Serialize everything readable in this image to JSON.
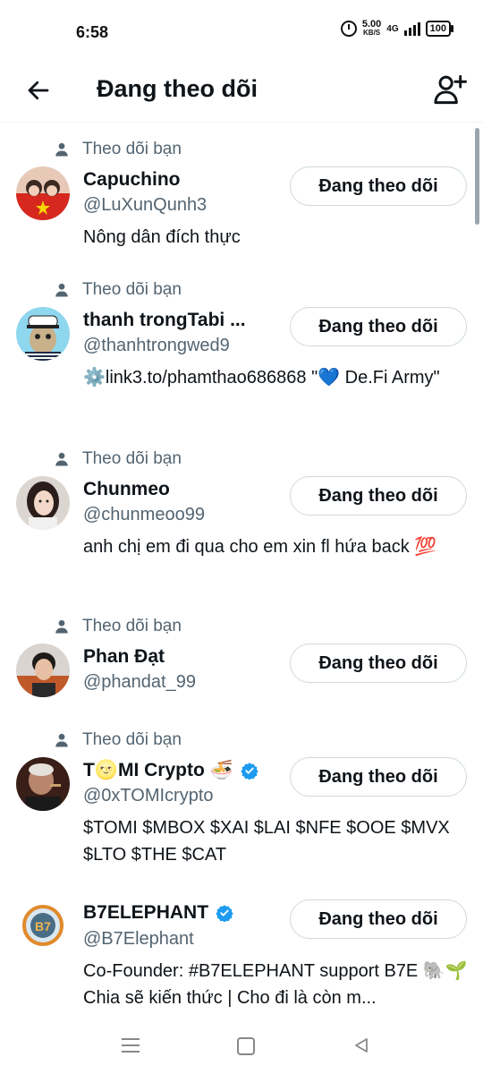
{
  "status_bar": {
    "time": "6:58",
    "net_speed_value": "5.00",
    "net_speed_unit": "KB/S",
    "network": "4G",
    "battery": "100"
  },
  "header": {
    "title": "Đang theo dõi",
    "back_icon": "arrow-left-icon",
    "add_icon": "add-user-icon"
  },
  "follows_you_label": "Theo dõi bạn",
  "users": [
    {
      "name": "Capuchino",
      "handle": "@LuXunQunh3",
      "bio": "Nông dân đích thực",
      "verified": false,
      "button": "Đang theo dõi"
    },
    {
      "name": "thanh trongTabi ...",
      "handle": "@thanhtrongwed9",
      "bio": "⚙️link3.to/phamthao686868  \"💙 De.Fi Army\"",
      "verified": false,
      "button": "Đang theo dõi"
    },
    {
      "name": "Chunmeo",
      "handle": "@chunmeoo99",
      "bio": "anh chị em đi qua cho em xin fl hứa back 💯",
      "verified": false,
      "button": "Đang theo dõi"
    },
    {
      "name": "Phan Đạt",
      "handle": "@phandat_99",
      "bio": "",
      "verified": false,
      "button": "Đang theo dõi"
    },
    {
      "name": "T🌝MI Crypto 🍜",
      "handle": "@0xTOMIcrypto",
      "bio": "$TOMI $MBOX $XAI $LAI $NFE $OOE $MVX $LTO $THE $CAT",
      "verified": true,
      "button": "Đang theo dõi"
    },
    {
      "name": "B7ELEPHANT",
      "handle": "@B7Elephant",
      "bio": "Co-Founder: #B7ELEPHANT support B7E 🐘🌱Chia sẽ kiến thức | Cho đi là còn m...",
      "verified": true,
      "button": "Đang theo dõi"
    }
  ],
  "colors": {
    "text_primary": "#0f1419",
    "text_secondary": "#536471",
    "button_border": "#cfd9de",
    "verified_blue": "#1d9bf0"
  }
}
